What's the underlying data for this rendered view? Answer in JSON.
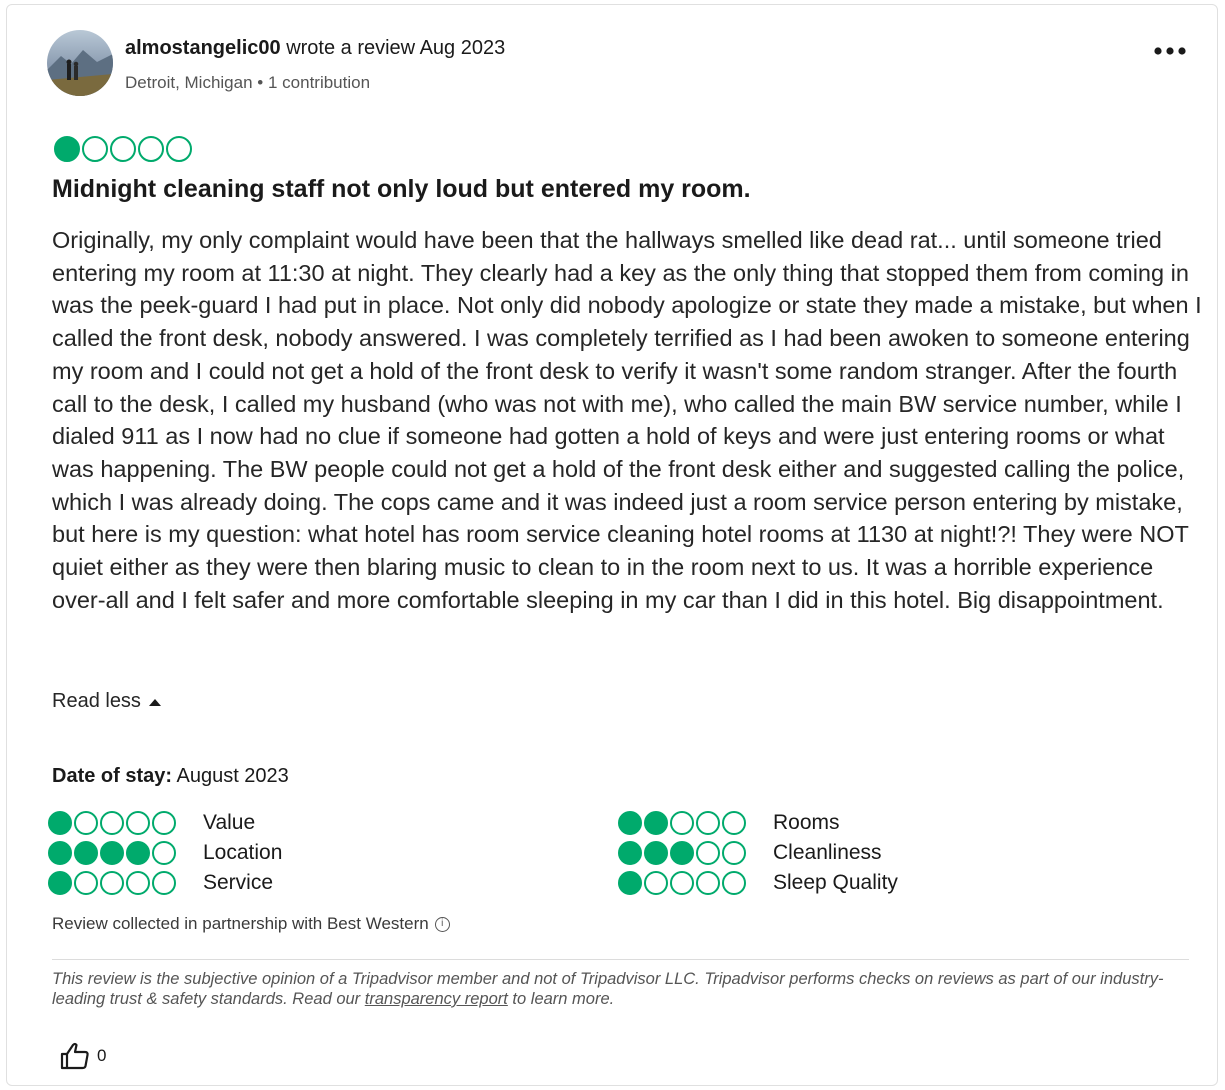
{
  "review": {
    "username": "almostangelic00",
    "wrote_text": "wrote a review Aug 2023",
    "location": "Detroit, Michigan",
    "separator": "•",
    "contributions": "1 contribution",
    "overall_rating": 1,
    "rating_max": 5,
    "title": "Midnight cleaning staff not only loud but entered my room.",
    "body": "Originally, my only complaint would have been that the hallways smelled like dead rat... until someone tried entering my room at 11:30 at night. They clearly had a key as the only thing that stopped them from coming in was the peek-guard I had put in place. Not only did nobody apologize or state they made a mistake, but when I called the front desk, nobody answered. I was completely terrified as I had been awoken to someone entering my room and I could not get a hold of the front desk to verify it wasn't some random stranger. After the fourth call to the desk, I called my husband (who was not with me), who called the main BW service number, while I dialed 911 as I now had no clue if someone had gotten a hold of keys and were just entering rooms or what was happening. The BW people could not get a hold of the front desk either and suggested calling the police, which I was already doing. The cops came and it was indeed just a room service person entering by mistake, but here is my question: what hotel has room service cleaning hotel rooms at 1130 at night!?! They were NOT quiet either as they were then blaring music to clean to in the room next to us. It was a horrible experience over-all and I felt safer and more comfortable sleeping in my car than I did in this hotel. Big disappointment.",
    "read_less_label": "Read less",
    "date_of_stay_label": "Date of stay:",
    "date_of_stay_value": "August 2023",
    "subratings_left": [
      {
        "label": "Value",
        "rating": 1
      },
      {
        "label": "Location",
        "rating": 4
      },
      {
        "label": "Service",
        "rating": 1
      }
    ],
    "subratings_right": [
      {
        "label": "Rooms",
        "rating": 2
      },
      {
        "label": "Cleanliness",
        "rating": 3
      },
      {
        "label": "Sleep Quality",
        "rating": 1
      }
    ],
    "partner_note": "Review collected in partnership with Best Western",
    "disclaimer_before": "This review is the subjective opinion of a Tripadvisor member and not of Tripadvisor LLC. Tripadvisor performs checks on reviews as part of our industry-leading trust & safety standards. Read our ",
    "disclaimer_link": "transparency report",
    "disclaimer_after": " to learn more.",
    "helpful_count": "0"
  },
  "colors": {
    "bubble_green": "#00aa6c",
    "text": "#1a1a1a",
    "muted": "#555555"
  },
  "icons": {
    "more": "more-options-icon",
    "helpful": "thumbs-up-icon",
    "info": "info-icon",
    "read_less": "caret-up-icon"
  }
}
